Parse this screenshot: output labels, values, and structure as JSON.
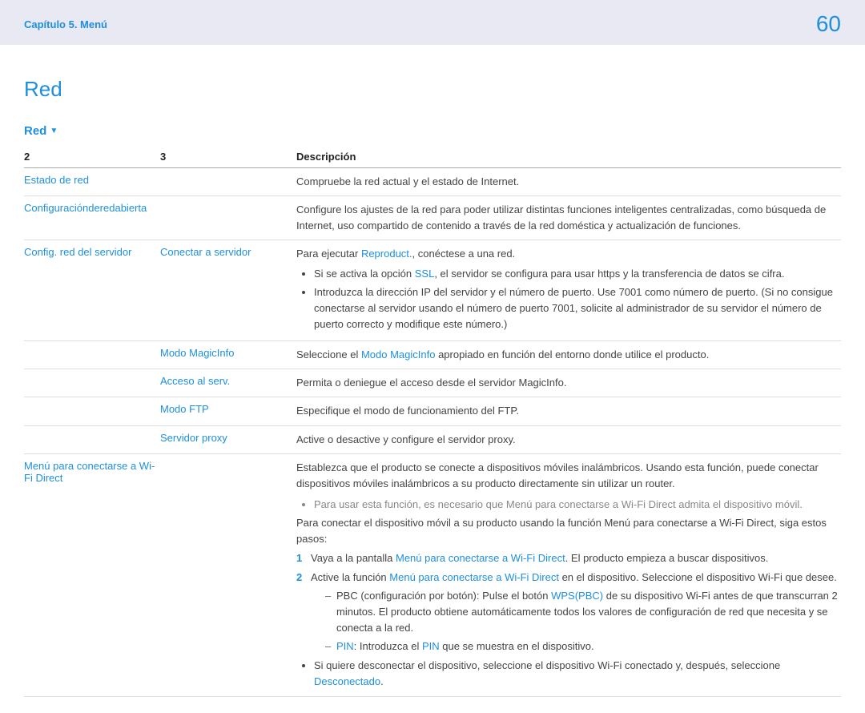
{
  "header": {
    "breadcrumb": "Capítulo 5. Menú",
    "page": "60"
  },
  "title": "Red",
  "section": "Red",
  "cols": {
    "c1": "2",
    "c2": "3",
    "c3": "Descripción"
  },
  "rows": {
    "r1": {
      "c1": "Estado de red",
      "desc": "Compruebe la red actual y el estado de Internet."
    },
    "r2": {
      "c1": "Configuraciónderedabierta",
      "desc": "Configure los ajustes de la red para poder utilizar distintas funciones inteligentes centralizadas, como búsqueda de Internet, uso compartido de contenido a través de la red doméstica y actualización de funciones."
    },
    "r3": {
      "c1": "Config. red del servidor",
      "c2": "Conectar a servidor",
      "lead_a": "Para ejecutar ",
      "lead_link": "Reproduct.",
      "lead_b": ", conéctese a una red.",
      "b1_a": "Si se activa la opción ",
      "b1_link": "SSL",
      "b1_b": ", el servidor se configura para usar https y la transferencia de datos se cifra.",
      "b2": "Introduzca la dirección IP del servidor y el número de puerto. Use 7001 como número de puerto. (Si no consigue conectarse al servidor usando el número de puerto 7001, solicite al administrador de su servidor el número de puerto correcto y modifique este número.)"
    },
    "r4": {
      "c2": "Modo MagicInfo",
      "a": "Seleccione el ",
      "link": "Modo MagicInfo",
      "b": " apropiado en función del entorno donde utilice el producto."
    },
    "r5": {
      "c2": "Acceso al serv.",
      "desc": "Permita o deniegue el acceso desde el servidor MagicInfo."
    },
    "r6": {
      "c2": "Modo FTP",
      "desc": "Especifique el modo de funcionamiento del FTP."
    },
    "r7": {
      "c2": "Servidor proxy",
      "desc": "Active o desactive y configure el servidor proxy."
    },
    "r8": {
      "c1": "Menú para conectarse a Wi-Fi Direct",
      "p1": "Establezca que el producto se conecte a dispositivos móviles inalámbricos. Usando esta función, puede conectar dispositivos móviles inalámbricos a su producto directamente sin utilizar un router.",
      "note": "Para usar esta función, es necesario que Menú para conectarse a Wi-Fi Direct admita el dispositivo móvil.",
      "p2": "Para conectar el dispositivo móvil a su producto usando la función Menú para conectarse a Wi-Fi Direct, siga estos pasos:",
      "s1_a": "Vaya a la pantalla ",
      "s1_link": "Menú para conectarse a Wi-Fi Direct",
      "s1_b": ". El producto empieza a buscar dispositivos.",
      "s2_a": "Active la función ",
      "s2_link": "Menú para conectarse a Wi-Fi Direct",
      "s2_b": " en el dispositivo. Seleccione el dispositivo Wi-Fi que desee.",
      "d1_a": "PBC (configuración por botón): Pulse el botón ",
      "d1_link": "WPS(PBC)",
      "d1_b": " de su dispositivo Wi-Fi antes de que transcurran 2 minutos. El producto obtiene automáticamente todos los valores de configuración de red que necesita y se conecta a la red.",
      "d2_pin": "PIN",
      "d2_a": ": Introduzca el ",
      "d2_link": "PIN",
      "d2_b": " que se muestra en el dispositivo.",
      "b_last_a": "Si quiere desconectar el dispositivo, seleccione el dispositivo Wi-Fi conectado y, después, seleccione ",
      "b_last_link": "Desconectado",
      "b_last_b": "."
    }
  }
}
